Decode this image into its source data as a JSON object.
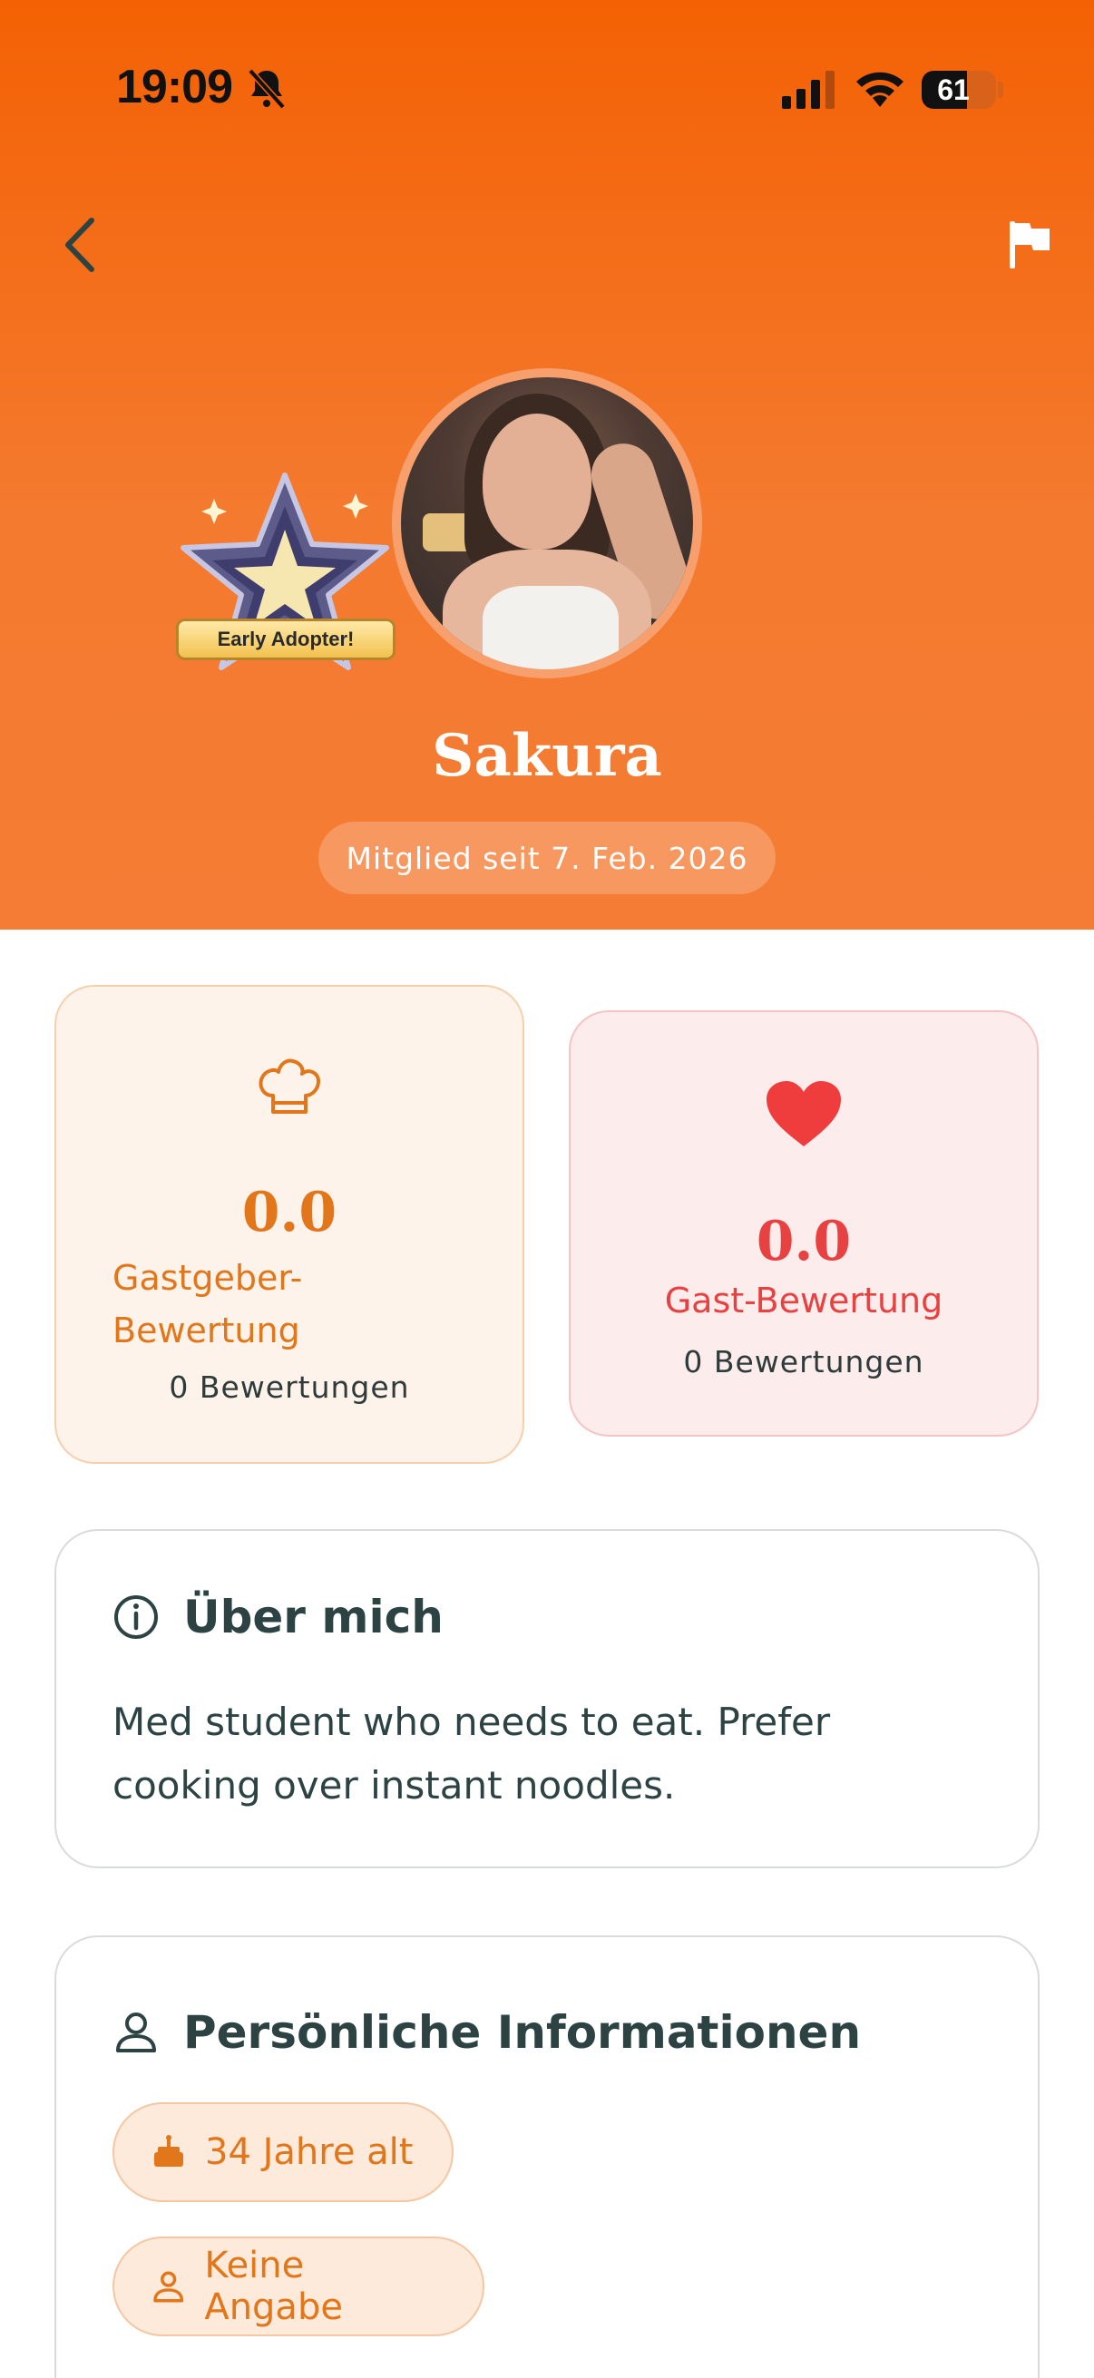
{
  "status_bar": {
    "time": "19:09",
    "battery": "61",
    "battery_level": 0.61
  },
  "header": {
    "badge_label": "Early Adopter!",
    "name": "Sakura",
    "member_since": "Mitglied seit 7. Feb. 2026"
  },
  "ratings": {
    "host": {
      "score": "0.0",
      "label": "Gastgeber-Bewertung",
      "label_line1": "Gastgeber-",
      "label_line2": "Bewertung",
      "count": "0 Bewertungen"
    },
    "guest": {
      "score": "0.0",
      "label": "Gast-Bewertung",
      "count": "0 Bewertungen"
    }
  },
  "about": {
    "title": "Über mich",
    "text": "Med student who needs to eat. Prefer cooking over instant noodles."
  },
  "personal": {
    "title": "Persönliche Informationen",
    "age": "34 Jahre alt",
    "gender": "Keine Angabe"
  },
  "colors": {
    "header": "#f46104",
    "accent": "#e2761b",
    "guest_accent": "#e84141",
    "text": "#2d4343"
  },
  "icons": [
    "bell-off-icon",
    "signal-icon",
    "wifi-icon",
    "battery-icon",
    "back-arrow-icon",
    "flag-icon",
    "chef-hat-icon",
    "heart-icon",
    "info-icon",
    "person-icon",
    "cake-icon"
  ]
}
